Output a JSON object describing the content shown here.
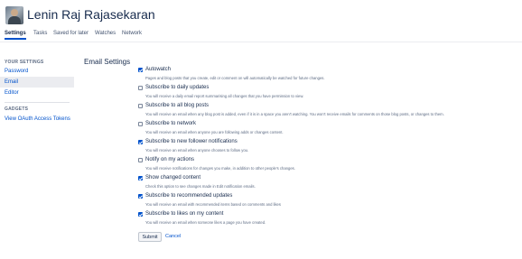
{
  "profile": {
    "name": "Lenin Raj Rajasekaran"
  },
  "tabs": [
    {
      "label": "Settings",
      "active": true
    },
    {
      "label": "Tasks",
      "active": false
    },
    {
      "label": "Saved for later",
      "active": false
    },
    {
      "label": "Watches",
      "active": false
    },
    {
      "label": "Network",
      "active": false
    }
  ],
  "sidebar": {
    "settings_heading": "YOUR SETTINGS",
    "settings_items": [
      {
        "label": "Password",
        "active": false
      },
      {
        "label": "Email",
        "active": true
      },
      {
        "label": "Editor",
        "active": false
      }
    ],
    "gadgets_heading": "GADGETS",
    "gadget_items": [
      {
        "label": "View OAuth Access Tokens"
      }
    ]
  },
  "main": {
    "title": "Email Settings",
    "options": [
      {
        "label": "Autowatch",
        "checked": true,
        "description": "Pages and blog posts that you create, edit or comment on will automatically be watched for future changes."
      },
      {
        "label": "Subscribe to daily updates",
        "checked": false,
        "description": "You will receive a daily email report summarising all changes that you have permission to view."
      },
      {
        "label": "Subscribe to all blog posts",
        "checked": false,
        "description": "You will receive an email when any blog post is added, even if it is in a space you aren't watching. You won't receive emails for comments on those blog posts, or changes to them."
      },
      {
        "label": "Subscribe to network",
        "checked": false,
        "description": "You will receive an email when anyone you are following adds or changes content."
      },
      {
        "label": "Subscribe to new follower notifications",
        "checked": true,
        "description": "You will receive an email when anyone chooses to follow you."
      },
      {
        "label": "Notify on my actions",
        "checked": false,
        "description": "You will receive notifications for changes you make, in addition to other people's changes."
      },
      {
        "label": "Show changed content",
        "checked": true,
        "description": "Check this option to see changes made in Edit notification emails."
      },
      {
        "label": "Subscribe to recommended updates",
        "checked": true,
        "description": "You will receive an email with recommended items based on comments and likes"
      },
      {
        "label": "Subscribe to likes on my content",
        "checked": true,
        "description": "You will receive an email when someone likes a page you have created."
      }
    ],
    "submit_label": "Submit",
    "cancel_label": "Cancel"
  },
  "colors": {
    "accent": "#0052cc",
    "text": "#172b4d",
    "muted": "#5e6c84",
    "selected_bg": "#ebecf0"
  }
}
